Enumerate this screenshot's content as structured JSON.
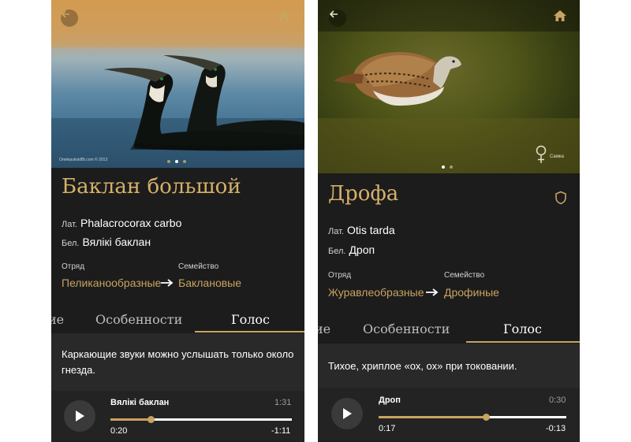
{
  "screens": [
    {
      "photo_watermark": "OnelepukoldBt.com © 2013",
      "name": "Баклан большой",
      "latin_label": "Лат.",
      "latin": "Phalacrocorax carbo",
      "belarusian_label": "Бел.",
      "belarusian": "Вялікі баклан",
      "order_label": "Отряд",
      "order": "Пеликанообразные",
      "family_label": "Семейство",
      "family": "Баклановые",
      "tabs": [
        "ие",
        "Особенности",
        "Голос"
      ],
      "active_tab": "Голос",
      "description_lines": [
        "Каркающие звуки можно услышать только около",
        "гнезда."
      ],
      "player": {
        "title": "Вялікі баклан",
        "duration": "1:31",
        "elapsed": "0:20",
        "remaining": "-1:11",
        "progress": 0.22
      },
      "gallery": {
        "count": 3,
        "active": 1
      }
    },
    {
      "name": "Дрофа",
      "sex_label": "Самка",
      "latin_label": "Лат.",
      "latin": "Otis tarda",
      "belarusian_label": "Бел.",
      "belarusian": "Дроп",
      "order_label": "Отряд",
      "order": "Журавлеобразные",
      "family_label": "Семейство",
      "family": "Дрофиные",
      "tabs": [
        "ие",
        "Особенности",
        "Голос"
      ],
      "active_tab": "Голос",
      "description_lines": [
        "Тихое, хриплое «ох, ох» при токовании."
      ],
      "player": {
        "title": "Дроп",
        "duration": "0:30",
        "elapsed": "0:17",
        "remaining": "-0:13",
        "progress": 0.57
      },
      "gallery": {
        "count": 2,
        "active": 0
      }
    }
  ],
  "colors": {
    "accent": "#c9a360",
    "title": "#d5b06a",
    "background": "#1c1c1c"
  },
  "icons": [
    "back-arrow-icon",
    "home-icon",
    "arrow-right-icon",
    "play-icon",
    "shield-icon",
    "female-symbol-icon"
  ]
}
